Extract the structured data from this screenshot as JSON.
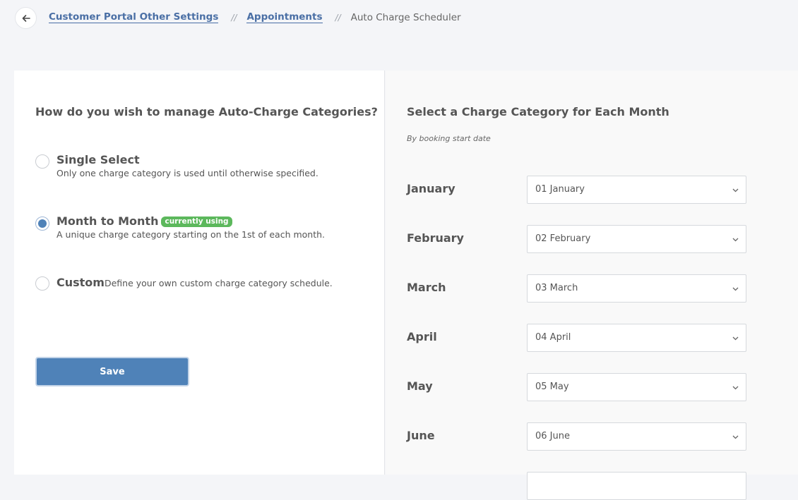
{
  "breadcrumb": {
    "items": [
      {
        "label": "Customer Portal Other Settings",
        "link": true
      },
      {
        "label": "Appointments",
        "link": true
      },
      {
        "label": "Auto Charge Scheduler",
        "link": false
      }
    ],
    "separator": "//"
  },
  "left": {
    "title": "How do you wish to manage Auto-Charge Categories?",
    "options": [
      {
        "title": "Single Select",
        "desc": "Only one charge category is used until otherwise specified.",
        "checked": false
      },
      {
        "title": "Month to Month",
        "badge": "currently using",
        "desc": "A unique charge category starting on the 1st of each month.",
        "checked": true
      },
      {
        "title": "Custom",
        "desc": "Define your own custom charge category schedule.",
        "checked": false
      }
    ],
    "save_label": "Save"
  },
  "right": {
    "title": "Select a Charge Category for Each Month",
    "subtitle": "By booking start date",
    "months": [
      {
        "label": "January",
        "value": "01 January"
      },
      {
        "label": "February",
        "value": "02 February"
      },
      {
        "label": "March",
        "value": "03 March"
      },
      {
        "label": "April",
        "value": "04 April"
      },
      {
        "label": "May",
        "value": "05 May"
      },
      {
        "label": "June",
        "value": "06 June"
      }
    ]
  },
  "icons": {
    "back": "arrow-left-icon",
    "select": "chevron-down-icon"
  },
  "colors": {
    "accent": "#4f82b8",
    "link": "#4a6fa5",
    "badge": "#5cb85c"
  }
}
